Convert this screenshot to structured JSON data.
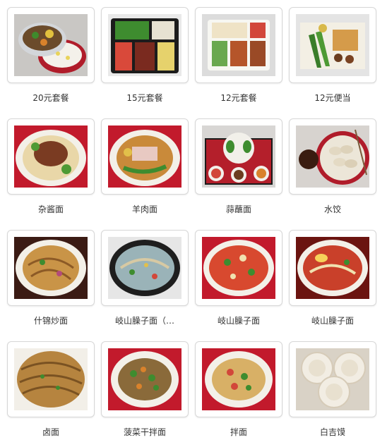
{
  "items": [
    {
      "caption": "20元套餐",
      "image": "bento-box-rice-meat"
    },
    {
      "caption": "15元套餐",
      "image": "bento-tray-vegetables"
    },
    {
      "caption": "12元套餐",
      "image": "bento-tray-fried"
    },
    {
      "caption": "12元便当",
      "image": "bento-box-sushi"
    },
    {
      "caption": "杂酱面",
      "image": "noodle-bowl-meat-sauce"
    },
    {
      "caption": "羊肉面",
      "image": "noodle-bowl-lamb"
    },
    {
      "caption": "蒜蘸面",
      "image": "noodle-set-dips"
    },
    {
      "caption": "水饺",
      "image": "dumplings-plate"
    },
    {
      "caption": "什锦炒面",
      "image": "fried-noodles-plate"
    },
    {
      "caption": "岐山臊子面（…",
      "image": "noodle-soup-dark-bowl"
    },
    {
      "caption": "岐山臊子面",
      "image": "noodle-soup-red"
    },
    {
      "caption": "岐山臊子面",
      "image": "noodle-soup-red-egg"
    },
    {
      "caption": "卤面",
      "image": "stir-fried-noodles"
    },
    {
      "caption": "菠菜干拌面",
      "image": "spinach-mixed-noodles"
    },
    {
      "caption": "拌面",
      "image": "mixed-noodles-plate"
    },
    {
      "caption": "白吉馍",
      "image": "baiji-buns"
    }
  ]
}
